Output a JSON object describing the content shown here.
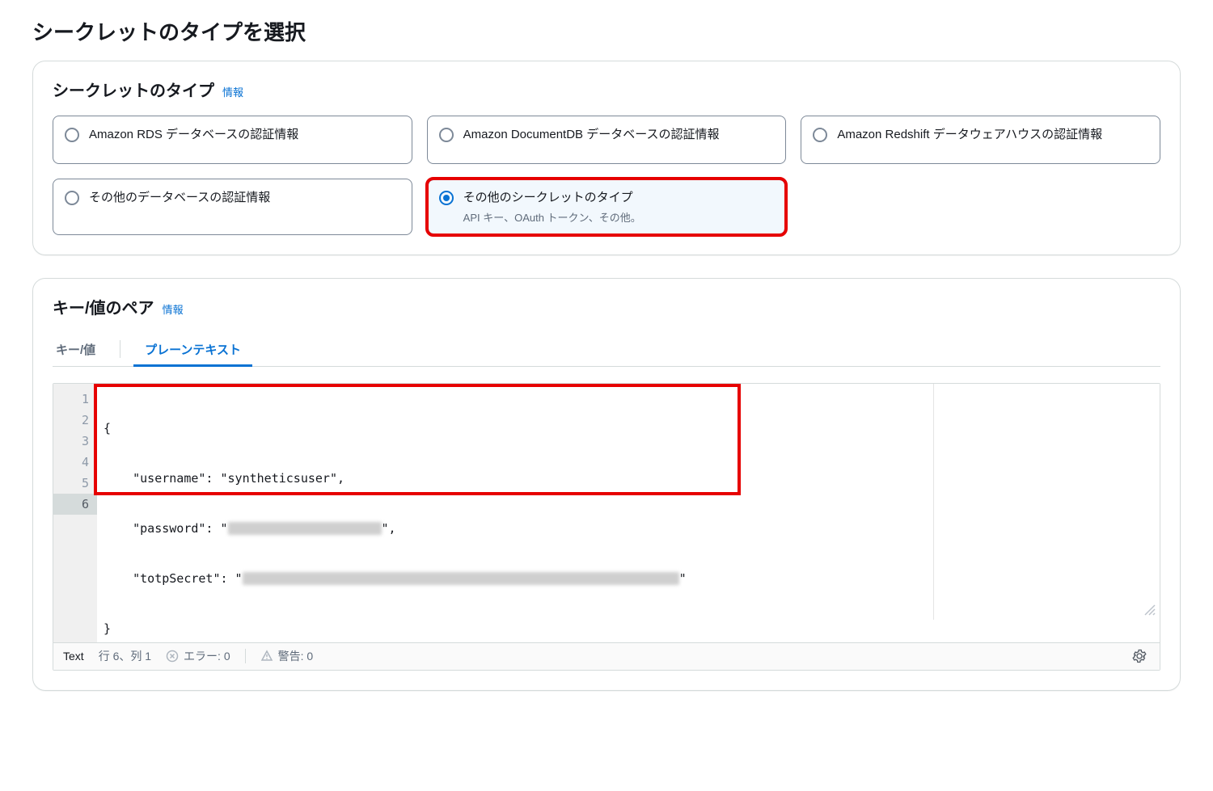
{
  "page": {
    "title": "シークレットのタイプを選択"
  },
  "secretType": {
    "panel_title": "シークレットのタイプ",
    "info_label": "情報",
    "options": [
      {
        "label": "Amazon RDS データベースの認証情報",
        "sub": "",
        "selected": false,
        "highlight": false
      },
      {
        "label": "Amazon DocumentDB データベースの認証情報",
        "sub": "",
        "selected": false,
        "highlight": false
      },
      {
        "label": "Amazon Redshift データウェアハウスの認証情報",
        "sub": "",
        "selected": false,
        "highlight": false
      },
      {
        "label": "その他のデータベースの認証情報",
        "sub": "",
        "selected": false,
        "highlight": false
      },
      {
        "label": "その他のシークレットのタイプ",
        "sub": "API キー、OAuth トークン、その他。",
        "selected": true,
        "highlight": true
      }
    ]
  },
  "kv": {
    "panel_title": "キー/値のペア",
    "info_label": "情報",
    "tabs": [
      {
        "label": "キー/値",
        "active": false
      },
      {
        "label": "プレーンテキスト",
        "active": true
      }
    ]
  },
  "editor": {
    "lines": {
      "l1": "{",
      "l2_prefix": "    \"username\": \"syntheticsuser\",",
      "l3_prefix": "    \"password\": \"",
      "l3_suffix": "\",",
      "l4_prefix": "    \"totpSecret\": \"",
      "l4_suffix": "\"",
      "l5": "}"
    },
    "line_numbers": [
      "1",
      "2",
      "3",
      "4",
      "5",
      "6"
    ],
    "status": {
      "mode": "Text",
      "cursor": "行 6、列 1",
      "errors_label": "エラー: 0",
      "warnings_label": "警告: 0"
    }
  }
}
